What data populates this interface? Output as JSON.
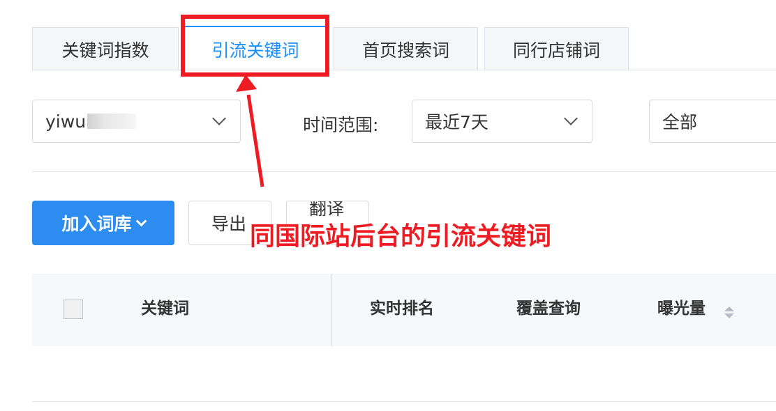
{
  "tabs": [
    {
      "label": "关键词指数",
      "active": false
    },
    {
      "label": "引流关键词",
      "active": true
    },
    {
      "label": "首页搜索词",
      "active": false
    },
    {
      "label": "同行店铺词",
      "active": false
    }
  ],
  "filters": {
    "store_select": {
      "value": "yiwu"
    },
    "time_label": "时间范围:",
    "time_select": {
      "value": "最近7天"
    },
    "scope_select": {
      "value": "全部"
    }
  },
  "actions": {
    "add_to_library": "加入词库",
    "export": "导出",
    "translate": "翻译"
  },
  "table": {
    "columns": [
      "关键词",
      "实时排名",
      "覆盖查询",
      "曝光量"
    ]
  },
  "annotation": {
    "text": "同国际站后台的引流关键词",
    "color": "#ee1b23"
  },
  "colors": {
    "accent": "#1890ff",
    "primary_button": "#2d8cf0",
    "annotation_red": "#ee1b23"
  },
  "icons": {
    "dropdown": "chevron-down-icon",
    "sort": "sort-icon",
    "arrow": "arrow-icon"
  }
}
